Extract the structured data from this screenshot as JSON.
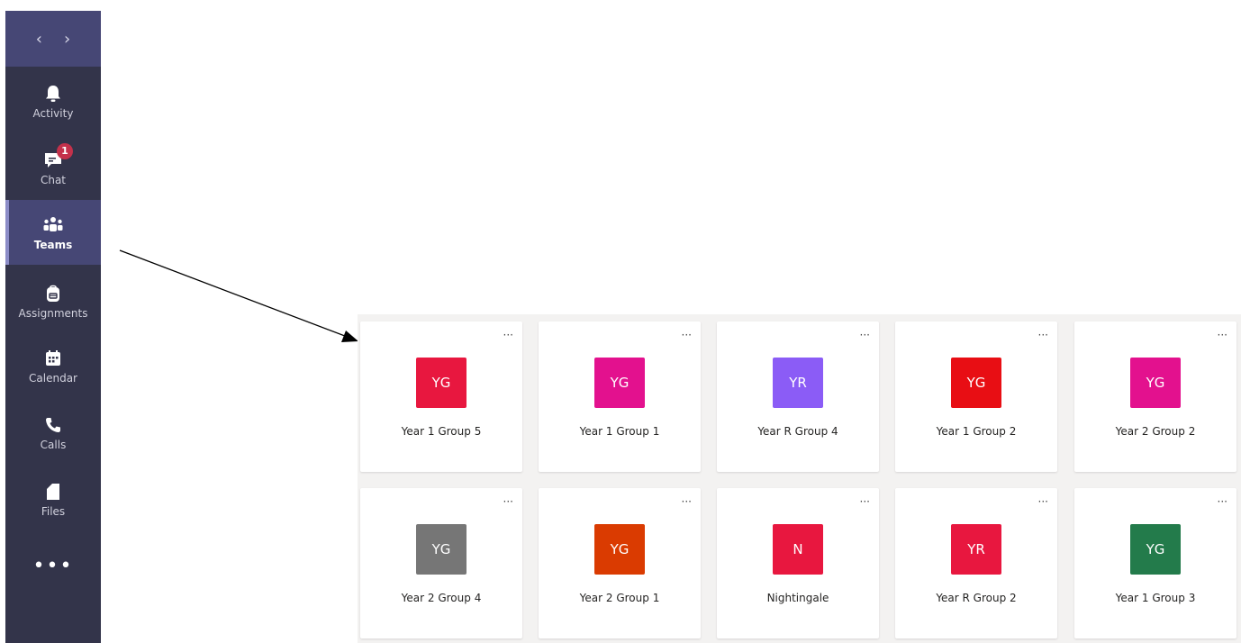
{
  "nav": {
    "back_glyph": "‹",
    "forward_glyph": "›"
  },
  "rail": {
    "items": [
      {
        "label": "Activity",
        "icon": "bell-icon"
      },
      {
        "label": "Chat",
        "icon": "chat-icon",
        "badge": "1"
      },
      {
        "label": "Teams",
        "icon": "teams-icon",
        "active": true
      },
      {
        "label": "Assignments",
        "icon": "backpack-icon"
      },
      {
        "label": "Calendar",
        "icon": "calendar-icon"
      },
      {
        "label": "Calls",
        "icon": "phone-icon"
      },
      {
        "label": "Files",
        "icon": "file-icon"
      }
    ],
    "more": "•••"
  },
  "teams": [
    {
      "initials": "YG",
      "name": "Year 1 Group 5",
      "color": "#e8173f"
    },
    {
      "initials": "YG",
      "name": "Year 1 Group 1",
      "color": "#e3118e"
    },
    {
      "initials": "YR",
      "name": "Year R Group 4",
      "color": "#8b5cf6"
    },
    {
      "initials": "YG",
      "name": "Year 1 Group 2",
      "color": "#e80e14"
    },
    {
      "initials": "YG",
      "name": "Year 2 Group 2",
      "color": "#e3118e"
    },
    {
      "initials": "YG",
      "name": "Year 2 Group 4",
      "color": "#767676"
    },
    {
      "initials": "YG",
      "name": "Year 2 Group 1",
      "color": "#da3b01"
    },
    {
      "initials": "N",
      "name": "Nightingale",
      "color": "#e8173f"
    },
    {
      "initials": "YR",
      "name": "Year R Group 2",
      "color": "#e8173f"
    },
    {
      "initials": "YG",
      "name": "Year 1 Group 3",
      "color": "#237b4b"
    }
  ],
  "card_more": "···",
  "colors": {
    "rail_bg": "#33344a",
    "rail_active": "#464775",
    "badge": "#c4314b"
  }
}
